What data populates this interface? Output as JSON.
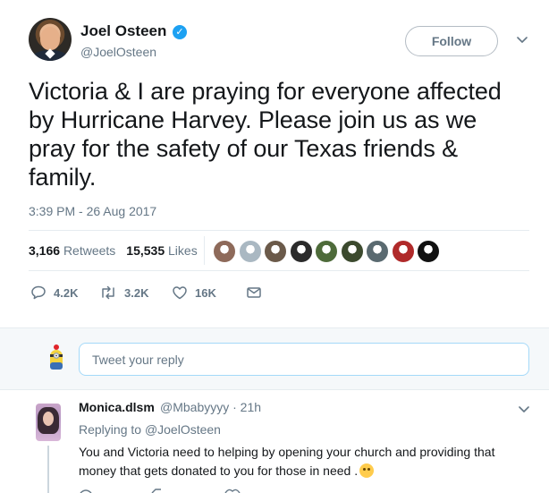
{
  "tweet": {
    "author_name": "Joel Osteen",
    "verified_mark": "✓",
    "author_handle": "@JoelOsteen",
    "follow_label": "Follow",
    "text": "Victoria & I are praying for everyone affected by Hurricane Harvey. Please join us as we pray for the safety of our Texas friends & family.",
    "timestamp": "3:39 PM - 26 Aug 2017",
    "stats": {
      "retweets_count": "3,166",
      "retweets_label": "Retweets",
      "likes_count": "15,535",
      "likes_label": "Likes"
    },
    "likers": [
      "#8e6a5a",
      "#aab8c2",
      "#6b5a4a",
      "#2b2b2b",
      "#4e6b3a",
      "#3c4a2e",
      "#5a6a70",
      "#b02a2a",
      "#111111"
    ],
    "actions": {
      "replies": "4.2K",
      "retweets": "3.2K",
      "likes": "16K"
    }
  },
  "reply_composer": {
    "placeholder": "Tweet your reply"
  },
  "reply": {
    "author_name": "Monica.dlsm",
    "author_handle": "@Mbabyyyy · 21h",
    "replying_prefix": "Replying to",
    "replying_to": "@JoelOsteen",
    "text": "You and Victoria need to helping by opening your church and providing that money that gets donated to you for those in  need ."
  },
  "colors": {
    "accent": "#1da1f2",
    "muted": "#657786",
    "text": "#14171a",
    "border": "#e6ecf0",
    "gap_bg": "#f5f8fa"
  }
}
